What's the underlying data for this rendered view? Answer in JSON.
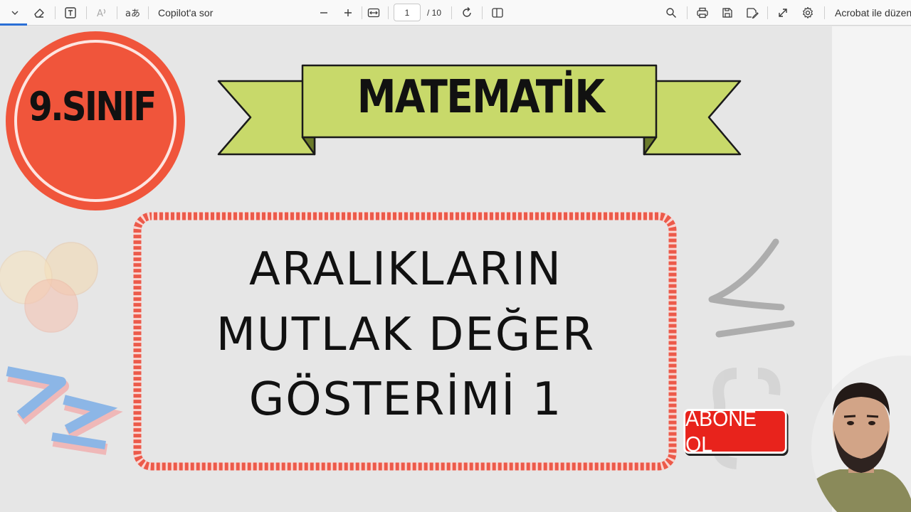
{
  "toolbar": {
    "ask_copilot": "Copilot'a sor",
    "page_current": "1",
    "page_total": "/ 10",
    "edit_in_acrobat": "Acrobat ile düzen",
    "icons": [
      "chevron-down-icon",
      "eraser-icon",
      "text-box-icon",
      "read-aloud-icon",
      "translate-icon",
      "zoom-out-icon",
      "zoom-in-icon",
      "fit-width-icon",
      "rotate-icon",
      "page-view-icon",
      "search-icon",
      "print-icon",
      "save-icon",
      "save-as-icon",
      "fullscreen-icon",
      "settings-icon"
    ]
  },
  "slide": {
    "grade_badge": "9.SINIF",
    "subject": "MATEMATİK",
    "title_lines": [
      "ARALIKLARIN",
      "MUTLAK DEĞER",
      "GÖSTERİMİ 1"
    ],
    "subscribe_button": "ABONE OL"
  },
  "colors": {
    "accent_red": "#f0553b",
    "ribbon_green": "#c8d96a",
    "rope_red": "#ec5a4a",
    "subscribe_red": "#e8231c"
  }
}
